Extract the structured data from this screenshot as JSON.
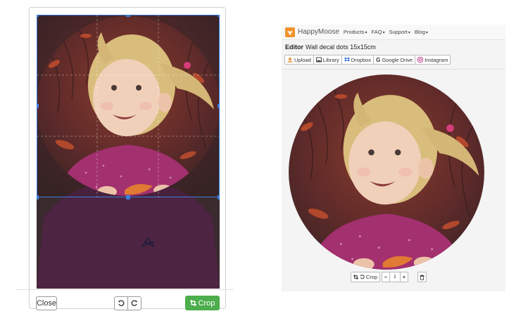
{
  "crop_modal": {
    "close_label": "Close",
    "crop_label": "Crop",
    "undo_icon": "undo-icon",
    "redo_icon": "redo-icon",
    "crop_icon": "crop-icon",
    "accent_color": "#4cae4c",
    "handle_color": "#3b7ddd"
  },
  "editor": {
    "brand_name": "HappyMoose",
    "nav": [
      "Products",
      "FAQ",
      "Support",
      "Blog"
    ],
    "title_bold": "Editor",
    "title_text": "Wall decal dots 15x15cm",
    "sources": [
      {
        "label": "Upload",
        "icon": "upload-icon",
        "color": "#e8892b"
      },
      {
        "label": "Library",
        "icon": "image-icon",
        "color": "#333333"
      },
      {
        "label": "Dropbox",
        "icon": "dropbox-icon",
        "color": "#2f6fd6"
      },
      {
        "label": "Google Drive",
        "icon": "google-icon",
        "color": "#333333"
      },
      {
        "label": "Instagram",
        "icon": "instagram-icon",
        "color": "#c13584"
      }
    ],
    "controls": {
      "crop_label": "Crop",
      "quantity": "1",
      "minus": "−",
      "plus": "+"
    }
  }
}
